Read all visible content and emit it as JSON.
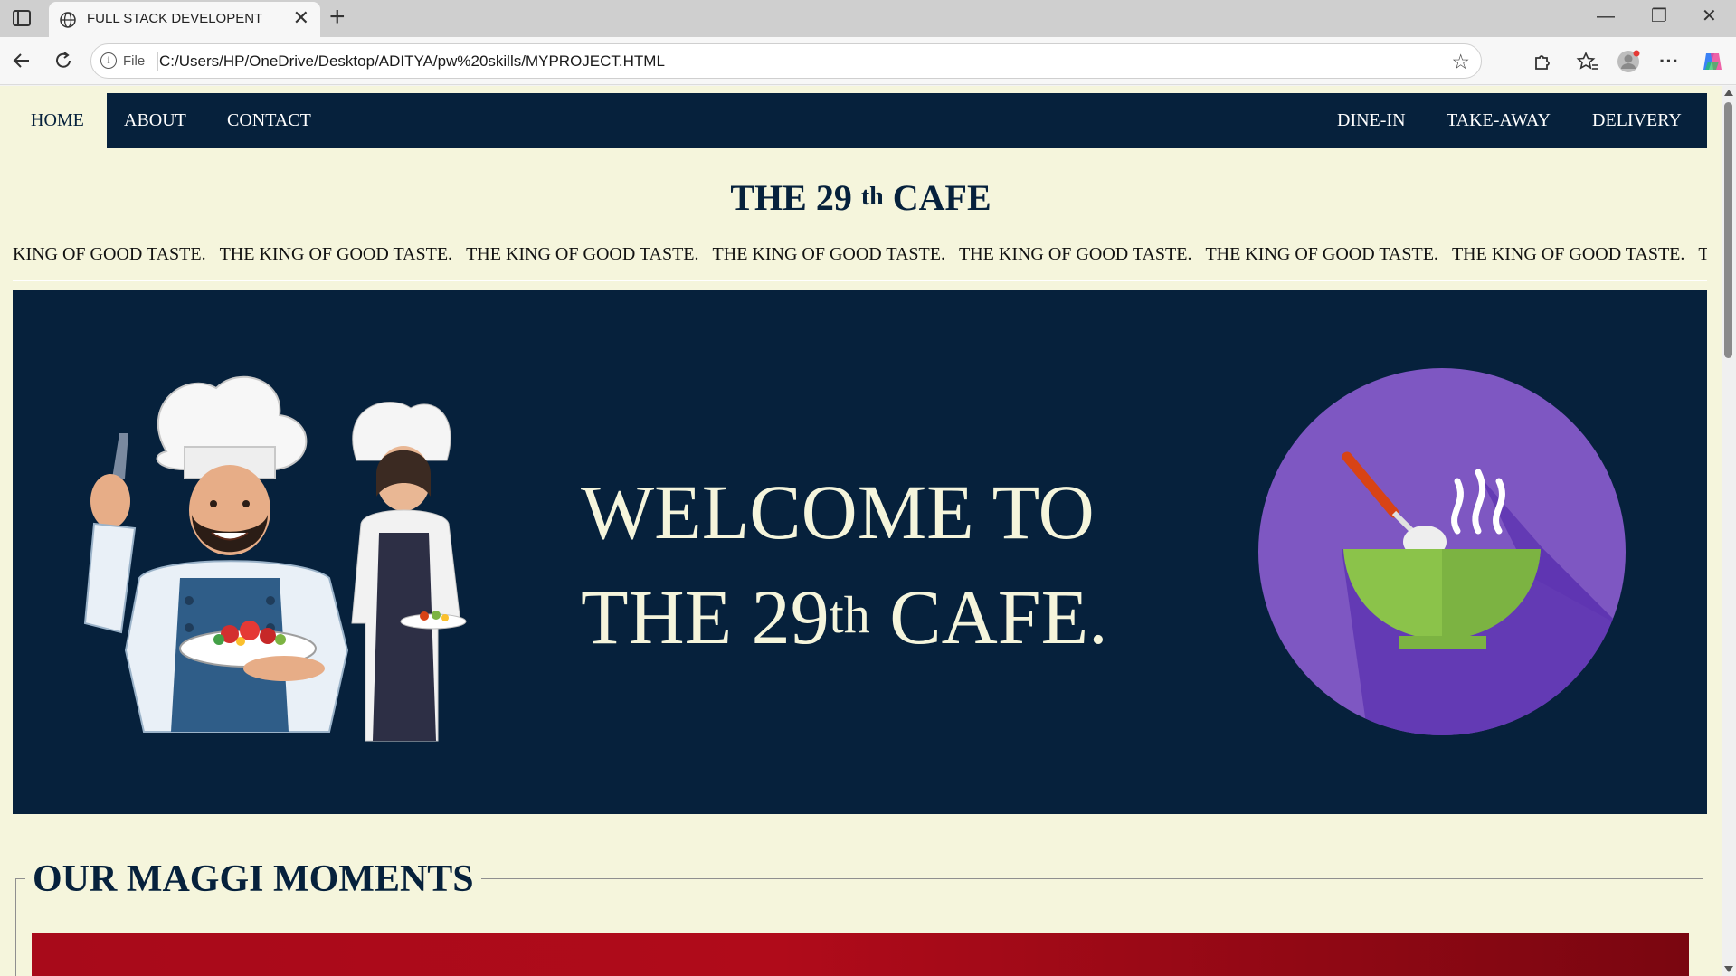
{
  "browser": {
    "tab_title": "FULL STACK DEVELOPENT",
    "scheme_label": "File",
    "url": "C:/Users/HP/OneDrive/Desktop/ADITYA/pw%20skills/MYPROJECT.HTML",
    "new_tab_glyph": "+",
    "close_glyph": "✕",
    "minimize_glyph": "—",
    "restore_glyph": "❐",
    "window_close_glyph": "✕",
    "more_glyph": "···"
  },
  "nav": {
    "left": [
      "HOME",
      "ABOUT",
      "CONTACT"
    ],
    "right": [
      "DINE-IN",
      "TAKE-AWAY",
      "DELIVERY"
    ],
    "active": "HOME"
  },
  "header": {
    "title_before": "THE 29 ",
    "title_sup": "th",
    "title_after": " CAFE"
  },
  "marquee": {
    "first": "KING OF GOOD TASTE.",
    "item": "THE KING OF GOOD TASTE."
  },
  "hero": {
    "line1": "WELCOME TO",
    "line2_before": "THE 29",
    "line2_sup": "th",
    "line2_after": " CAFE."
  },
  "section": {
    "title": "OUR MAGGI MOMENTS"
  },
  "colors": {
    "navy": "#06213c",
    "cream": "#f5f5dc",
    "purple": "#7e57c2",
    "bowl_green": "#8bc34a"
  },
  "icons": [
    "globe-icon",
    "sidebar-toggle-icon",
    "back-icon",
    "reload-icon",
    "info-icon",
    "favorite-star-icon",
    "extensions-icon",
    "favorites-icon",
    "profile-icon",
    "more-icon",
    "copilot-icon",
    "chef-illustration",
    "food-bowl-icon"
  ]
}
